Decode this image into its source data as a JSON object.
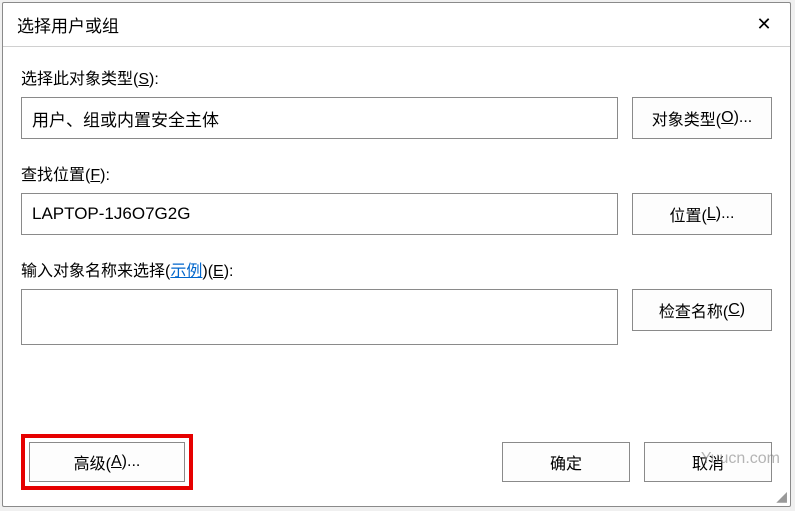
{
  "titlebar": {
    "title": "选择用户或组",
    "close": "✕"
  },
  "object_type": {
    "label_prefix": "选择此对象类型(",
    "label_mnemonic": "S",
    "label_suffix": "):",
    "value": "用户、组或内置安全主体",
    "button_prefix": "对象类型(",
    "button_mnemonic": "O",
    "button_suffix": ")..."
  },
  "location": {
    "label_prefix": "查找位置(",
    "label_mnemonic": "F",
    "label_suffix": "):",
    "value": "LAPTOP-1J6O7G2G",
    "button_prefix": "位置(",
    "button_mnemonic": "L",
    "button_suffix": ")..."
  },
  "names": {
    "label_prefix": "输入对象名称来选择(",
    "example_link": "示例",
    "label_mnemonic_open": ")(",
    "label_mnemonic": "E",
    "label_suffix": "):",
    "value": "",
    "check_prefix": "检查名称(",
    "check_mnemonic": "C",
    "check_suffix": ")"
  },
  "buttons": {
    "advanced_prefix": "高级(",
    "advanced_mnemonic": "A",
    "advanced_suffix": ")...",
    "ok": "确定",
    "cancel": "取消"
  },
  "watermark": "Yuucn.com"
}
